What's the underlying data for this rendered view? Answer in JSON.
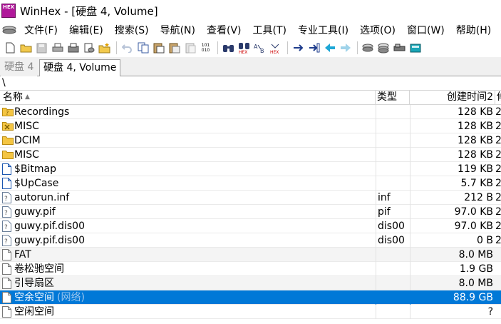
{
  "window": {
    "title": "WinHex - [硬盘 4, Volume]",
    "app_icon_text": "HEX"
  },
  "menu": [
    "文件(F)",
    "编辑(E)",
    "搜索(S)",
    "导航(N)",
    "查看(V)",
    "工具(T)",
    "专业工具(I)",
    "选项(O)",
    "窗口(W)",
    "帮助(H)"
  ],
  "toolbar": {
    "tools": [
      "new-file-icon",
      "open-folder-icon",
      "save-icon",
      "print-icon",
      "properties-icon",
      "open-disk-icon",
      "open-folder-star-icon",
      "undo-icon",
      "copy-icon",
      "paste-icon",
      "paste-special-icon",
      "clipboard-icon",
      "hex-convert-icon",
      "find-text-icon",
      "find-hex-icon",
      "replace-text-icon",
      "replace-hex-icon",
      "goto-offset-icon",
      "goto-position-icon",
      "back-icon",
      "forward-icon",
      "disk-editor-icon",
      "ram-editor-icon",
      "disk-tools-icon",
      "calculator-icon"
    ],
    "hex_label": "HEX",
    "bin_label": "101 010"
  },
  "tabs": [
    {
      "label": "硬盘 4",
      "active": false
    },
    {
      "label": "硬盘 4, Volume",
      "active": true
    }
  ],
  "path": "\\",
  "columns": {
    "name": "名称",
    "type": "类型",
    "size": "创建时间2",
    "extra": "修"
  },
  "files": [
    {
      "name": "Recordings",
      "suffix": "",
      "type": "",
      "size": "128 KB",
      "extra": "2",
      "icon": "folder-special",
      "alt": false,
      "selected": false
    },
    {
      "name": "MISC",
      "suffix": "",
      "type": "",
      "size": "128 KB",
      "extra": "2",
      "icon": "folder-deleted",
      "alt": false,
      "selected": false
    },
    {
      "name": "DCIM",
      "suffix": "",
      "type": "",
      "size": "128 KB",
      "extra": "2",
      "icon": "folder",
      "alt": false,
      "selected": false
    },
    {
      "name": "MISC",
      "suffix": "",
      "type": "",
      "size": "128 KB",
      "extra": "2",
      "icon": "folder",
      "alt": false,
      "selected": false
    },
    {
      "name": "$Bitmap",
      "suffix": "",
      "type": "",
      "size": "119 KB",
      "extra": "2",
      "icon": "file-blue",
      "alt": false,
      "selected": false
    },
    {
      "name": "$UpCase",
      "suffix": "",
      "type": "",
      "size": "5.7 KB",
      "extra": "2",
      "icon": "file-blue",
      "alt": false,
      "selected": false
    },
    {
      "name": "autorun.inf",
      "suffix": "",
      "type": "inf",
      "size": "212 B",
      "extra": "2",
      "icon": "file-q",
      "alt": false,
      "selected": false
    },
    {
      "name": "guwy.pif",
      "suffix": "",
      "type": "pif",
      "size": "97.0 KB",
      "extra": "2",
      "icon": "file-q",
      "alt": false,
      "selected": false
    },
    {
      "name": "guwy.pif.dis00",
      "suffix": "",
      "type": "dis00",
      "size": "97.0 KB",
      "extra": "2",
      "icon": "file-q",
      "alt": false,
      "selected": false
    },
    {
      "name": "guwy.pif.dis00",
      "suffix": "",
      "type": "dis00",
      "size": "0 B",
      "extra": "2",
      "icon": "file-q",
      "alt": false,
      "selected": false
    },
    {
      "name": "FAT",
      "suffix": "",
      "type": "",
      "size": "8.0 MB",
      "extra": "",
      "icon": "file-plain",
      "alt": true,
      "selected": false
    },
    {
      "name": "卷松驰空间",
      "suffix": "",
      "type": "",
      "size": "1.9 GB",
      "extra": "",
      "icon": "file-plain",
      "alt": false,
      "selected": false
    },
    {
      "name": "引导扇区",
      "suffix": "",
      "type": "",
      "size": "8.0 MB",
      "extra": "",
      "icon": "file-plain",
      "alt": true,
      "selected": false
    },
    {
      "name": "空余空间",
      "suffix": "(网络)",
      "type": "",
      "size": "88.9 GB",
      "extra": "",
      "icon": "file-plain",
      "alt": false,
      "selected": true
    },
    {
      "name": "空闲空间",
      "suffix": "",
      "type": "",
      "size": "?",
      "extra": "",
      "icon": "file-plain",
      "alt": false,
      "selected": false
    }
  ]
}
